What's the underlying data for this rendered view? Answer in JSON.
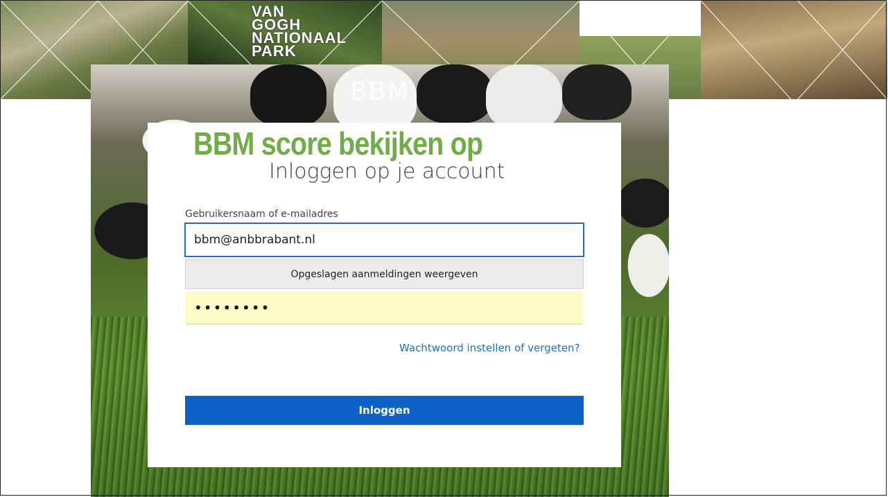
{
  "banner": {
    "logo_lines": [
      "VAN",
      "GOGH",
      "NATIONAAL",
      "PARK"
    ]
  },
  "background": {
    "brand_logo": "BBM"
  },
  "slide": {
    "title": "BBM score bekijken op",
    "title_color": "#70ad47"
  },
  "login": {
    "heading": "Inloggen op je account",
    "username_label": "Gebruikersnaam of e-mailadres",
    "username_value": "bbm@anbbrabant.nl",
    "saved_logins_label": "Opgeslagen aanmeldingen weergeven",
    "password_masked": "••••••••",
    "forgot_link": "Wachtwoord instellen of vergeten?",
    "submit_label": "Inloggen",
    "accent_color": "#0f61c8",
    "autofill_color": "#fefcc6"
  }
}
